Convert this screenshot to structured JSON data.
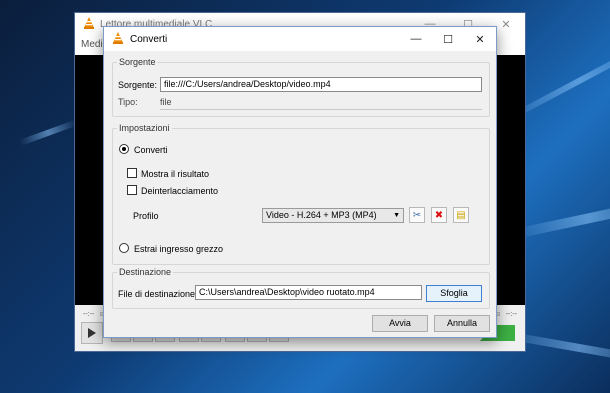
{
  "vlc": {
    "title": "Lettore multimediale VLC",
    "menu_partial": "Media",
    "time_left": "--:--",
    "time_right": "--:--",
    "window_controls": [
      "—",
      "☐",
      "✕"
    ]
  },
  "dialog": {
    "title": "Converti",
    "window_controls": [
      "—",
      "☐",
      "✕"
    ],
    "source": {
      "legend": "Sorgente",
      "source_label": "Sorgente:",
      "source_value": "file:///C:/Users/andrea/Desktop/video.mp4",
      "type_label": "Tipo:",
      "type_value": "file"
    },
    "settings": {
      "legend": "Impostazioni",
      "convert_label": "Converti",
      "show_result_label": "Mostra il risultato",
      "deinterlace_label": "Deinterlacciamento",
      "profile_label": "Profilo",
      "profile_value": "Video - H.264 + MP3 (MP4)",
      "raw_input_label": "Estrai ingresso grezzo"
    },
    "destination": {
      "legend": "Destinazione",
      "file_label": "File di destinazione:",
      "file_value": "C:\\Users\\andrea\\Desktop\\video ruotato.mp4",
      "browse_label": "Sfoglia"
    },
    "start_label": "Avvia",
    "cancel_label": "Annulla"
  }
}
